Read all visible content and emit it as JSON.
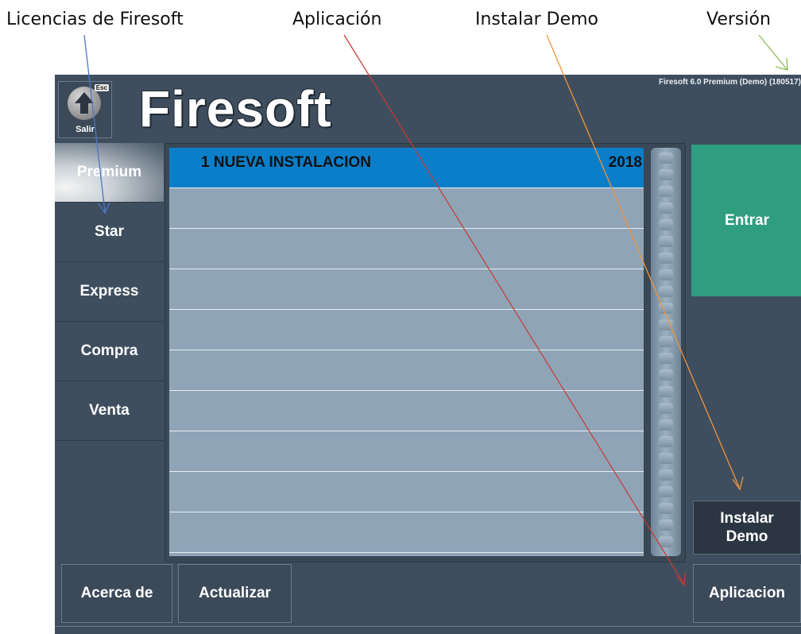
{
  "callouts": {
    "licencias": "Licencias de Firesoft",
    "aplicacion": "Aplicación",
    "instalar_demo": "Instalar Demo",
    "version": "Versión"
  },
  "header": {
    "exit_label": "Salir",
    "exit_key": "Esc",
    "logo": "Firesoft",
    "version": "Firesoft 6.0 Premium (Demo) (180517)"
  },
  "sidebar": {
    "items": [
      {
        "label": "Premium",
        "active": true
      },
      {
        "label": "Star"
      },
      {
        "label": "Express"
      },
      {
        "label": "Compra"
      },
      {
        "label": "Venta"
      }
    ]
  },
  "list": {
    "rows": [
      {
        "name": "1  NUEVA INSTALACION",
        "year": "2018",
        "selected": true
      }
    ]
  },
  "buttons": {
    "entrar": "Entrar",
    "instalar_demo_line1": "Instalar",
    "instalar_demo_line2": "Demo",
    "acerca": "Acerca de",
    "actualizar": "Actualizar",
    "aplicacion": "Aplicacion"
  },
  "colors": {
    "app_bg": "#3f4e5e",
    "selected_row": "#0a7ec8",
    "list_bg": "#8fa4b7",
    "entrar_bg": "#2f9e7e",
    "arrow_licencias": "#4a78c8",
    "arrow_aplicacion": "#c83a32",
    "arrow_demo": "#f0953c",
    "arrow_version": "#8dbb52"
  }
}
